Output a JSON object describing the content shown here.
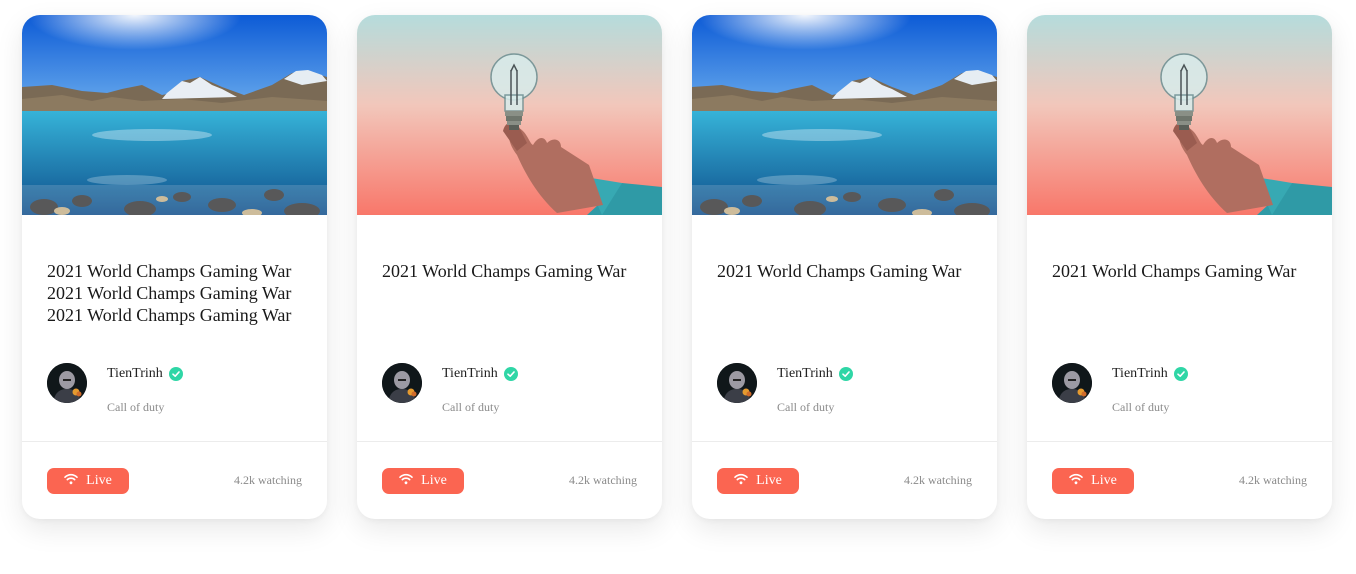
{
  "cards": [
    {
      "image": "mountain-lake",
      "title": "2021 World Champs Gaming War\n2021 World Champs Gaming War\n2021 World Champs Gaming War",
      "author": "TienTrinh",
      "game": "Call of duty",
      "live_label": "Live",
      "watching": "4.2k watching"
    },
    {
      "image": "lightbulb-hand",
      "title": "2021 World Champs Gaming War",
      "author": "TienTrinh",
      "game": "Call of duty",
      "live_label": "Live",
      "watching": "4.2k watching"
    },
    {
      "image": "mountain-lake",
      "title": "2021 World Champs Gaming War",
      "author": "TienTrinh",
      "game": "Call of duty",
      "live_label": "Live",
      "watching": "4.2k watching"
    },
    {
      "image": "lightbulb-hand",
      "title": "2021 World Champs Gaming War",
      "author": "TienTrinh",
      "game": "Call of duty",
      "live_label": "Live",
      "watching": "4.2k watching"
    }
  ],
  "icons": {
    "verified": "verified-check-icon",
    "live": "wifi-signal-icon"
  },
  "colors": {
    "live_button": "#fb6551",
    "verified_badge": "#2fd6a6",
    "muted_text": "#8a8a8a"
  }
}
